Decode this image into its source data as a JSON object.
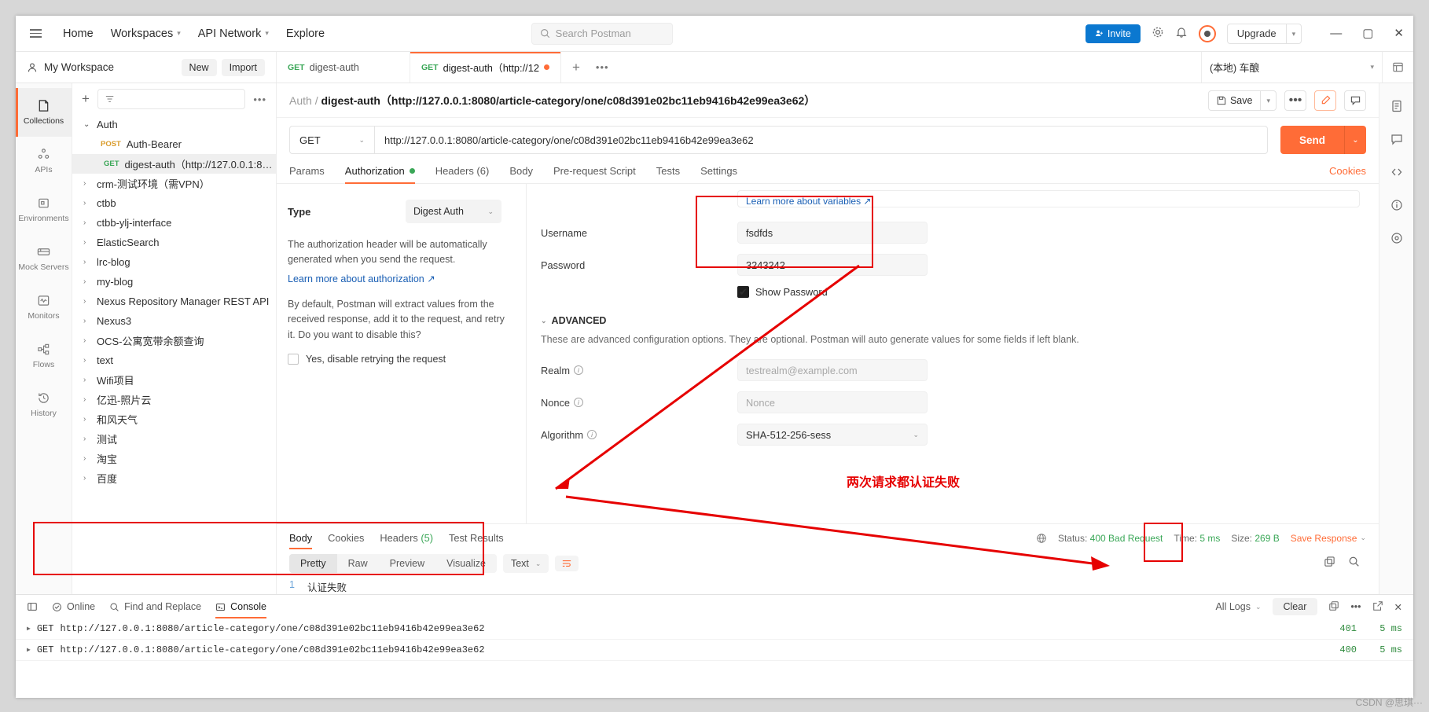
{
  "topbar": {
    "menu": [
      {
        "label": "Home",
        "caret": false
      },
      {
        "label": "Workspaces",
        "caret": true
      },
      {
        "label": "API Network",
        "caret": true
      },
      {
        "label": "Explore",
        "caret": false
      }
    ],
    "search_placeholder": "Search Postman",
    "invite_label": "Invite",
    "upgrade_label": "Upgrade",
    "icons": {
      "hamburger": "hamburger-icon",
      "search": "search-icon",
      "settings": "gear-icon",
      "notifications": "bell-icon",
      "account": "account-avatar-icon",
      "minimize": "minimize-icon",
      "maximize": "maximize-icon",
      "close": "close-icon"
    }
  },
  "workspace_bar": {
    "name": "My Workspace",
    "new_label": "New",
    "import_label": "Import",
    "tabs": [
      {
        "method": "GET",
        "label": "digest-auth",
        "active": false,
        "dirty": false
      },
      {
        "method": "GET",
        "label": "digest-auth（http://12",
        "active": true,
        "dirty": true
      }
    ],
    "environment": "(本地) 车酿",
    "plus_label": "+",
    "dots_label": "•••"
  },
  "rail": [
    {
      "label": "Collections",
      "icon": "collections-icon",
      "active": true
    },
    {
      "label": "APIs",
      "icon": "apis-icon",
      "active": false
    },
    {
      "label": "Environments",
      "icon": "environments-icon",
      "active": false
    },
    {
      "label": "Mock Servers",
      "icon": "mock-servers-icon",
      "active": false
    },
    {
      "label": "Monitors",
      "icon": "monitors-icon",
      "active": false
    },
    {
      "label": "Flows",
      "icon": "flows-icon",
      "active": false
    },
    {
      "label": "History",
      "icon": "history-icon",
      "active": false
    }
  ],
  "collections": {
    "filter_placeholder": "",
    "items": [
      {
        "label": "Auth",
        "type": "folder",
        "expanded": true,
        "indent": 0
      },
      {
        "label": "Auth-Bearer",
        "type": "request",
        "method": "POST",
        "indent": 1
      },
      {
        "label": "digest-auth（http://127.0.0.1:80...",
        "type": "request",
        "method": "GET",
        "indent": 1,
        "selected": true
      },
      {
        "label": "crm-测试环境（需VPN）",
        "type": "folder",
        "expanded": false,
        "indent": 0
      },
      {
        "label": "ctbb",
        "type": "folder",
        "expanded": false,
        "indent": 0
      },
      {
        "label": "ctbb-ylj-interface",
        "type": "folder",
        "expanded": false,
        "indent": 0
      },
      {
        "label": "ElasticSearch",
        "type": "folder",
        "expanded": false,
        "indent": 0
      },
      {
        "label": "lrc-blog",
        "type": "folder",
        "expanded": false,
        "indent": 0
      },
      {
        "label": "my-blog",
        "type": "folder",
        "expanded": false,
        "indent": 0
      },
      {
        "label": "Nexus Repository Manager REST API",
        "type": "folder",
        "expanded": false,
        "indent": 0
      },
      {
        "label": "Nexus3",
        "type": "folder",
        "expanded": false,
        "indent": 0
      },
      {
        "label": "OCS-公寓宽带余额查询",
        "type": "folder",
        "expanded": false,
        "indent": 0
      },
      {
        "label": "text",
        "type": "folder",
        "expanded": false,
        "indent": 0
      },
      {
        "label": "Wifi项目",
        "type": "folder",
        "expanded": false,
        "indent": 0
      },
      {
        "label": "亿迅-照片云",
        "type": "folder",
        "expanded": false,
        "indent": 0
      },
      {
        "label": "和风天气",
        "type": "folder",
        "expanded": false,
        "indent": 0
      },
      {
        "label": "测试",
        "type": "folder",
        "expanded": false,
        "indent": 0
      },
      {
        "label": "淘宝",
        "type": "folder",
        "expanded": false,
        "indent": 0
      },
      {
        "label": "百度",
        "type": "folder",
        "expanded": false,
        "indent": 0
      }
    ]
  },
  "request": {
    "breadcrumb_parent": "Auth",
    "breadcrumb_sep": "/",
    "breadcrumb_name": "digest-auth（http://127.0.0.1:8080/article-category/one/c08d391e02bc11eb9416b42e99ea3e62）",
    "save_label": "Save",
    "method": "GET",
    "url": "http://127.0.0.1:8080/article-category/one/c08d391e02bc11eb9416b42e99ea3e62",
    "send_label": "Send",
    "tabs": [
      {
        "label": "Params",
        "active": false,
        "dot": false,
        "count": ""
      },
      {
        "label": "Authorization",
        "active": true,
        "dot": true,
        "count": ""
      },
      {
        "label": "Headers (6)",
        "active": false,
        "dot": false,
        "count": ""
      },
      {
        "label": "Body",
        "active": false,
        "dot": false,
        "count": ""
      },
      {
        "label": "Pre-request Script",
        "active": false,
        "dot": false,
        "count": ""
      },
      {
        "label": "Tests",
        "active": false,
        "dot": false,
        "count": ""
      },
      {
        "label": "Settings",
        "active": false,
        "dot": false,
        "count": ""
      }
    ],
    "cookies_label": "Cookies"
  },
  "authorization": {
    "type_label": "Type",
    "type_value": "Digest Auth",
    "description": "The authorization header will be automatically generated when you send the request.",
    "learn_link": "Learn more about authorization ↗",
    "retry_text": "By default, Postman will extract values from the received response, add it to the request, and retry it. Do you want to disable this?",
    "disable_retry_label": "Yes, disable retrying the request",
    "variables_hint": "Learn more about variables ↗",
    "username_label": "Username",
    "username_value": "fsdfds",
    "password_label": "Password",
    "password_value": "3243242",
    "show_password_label": "Show Password",
    "advanced_label": "ADVANCED",
    "advanced_desc": "These are advanced configuration options. They are optional. Postman will auto generate values for some fields if left blank.",
    "realm_label": "Realm",
    "realm_placeholder": "testrealm@example.com",
    "nonce_label": "Nonce",
    "nonce_placeholder": "Nonce",
    "algorithm_label": "Algorithm",
    "algorithm_value": "SHA-512-256-sess"
  },
  "response": {
    "tabs": [
      {
        "label": "Body",
        "count": "",
        "active": true
      },
      {
        "label": "Cookies",
        "count": "",
        "active": false
      },
      {
        "label": "Headers",
        "count": "(5)",
        "active": false
      },
      {
        "label": "Test Results",
        "count": "",
        "active": false
      }
    ],
    "status_label": "Status:",
    "status_value": "400 Bad Request",
    "time_label": "Time:",
    "time_value": "5 ms",
    "size_label": "Size:",
    "size_value": "269 B",
    "save_response_label": "Save Response",
    "format_tabs": [
      "Pretty",
      "Raw",
      "Preview",
      "Visualize"
    ],
    "format_active": "Pretty",
    "content_type": "Text",
    "body_lines": [
      {
        "n": "1",
        "text": "认证失败"
      }
    ],
    "copy_icon": "copy-icon",
    "search_icon": "search-icon"
  },
  "console": {
    "online_label": "Online",
    "find_replace_label": "Find and Replace",
    "console_label": "Console",
    "all_logs_label": "All Logs",
    "clear_label": "Clear",
    "rows": [
      {
        "method": "GET",
        "url": "http://127.0.0.1:8080/article-category/one/c08d391e02bc11eb9416b42e99ea3e62",
        "code": "401",
        "time": "5 ms"
      },
      {
        "method": "GET",
        "url": "http://127.0.0.1:8080/article-category/one/c08d391e02bc11eb9416b42e99ea3e62",
        "code": "400",
        "time": "5 ms"
      }
    ]
  },
  "annotations": {
    "note": "两次请求都认证失败",
    "color": "#e60000"
  },
  "watermark": "CSDN @思琪···"
}
